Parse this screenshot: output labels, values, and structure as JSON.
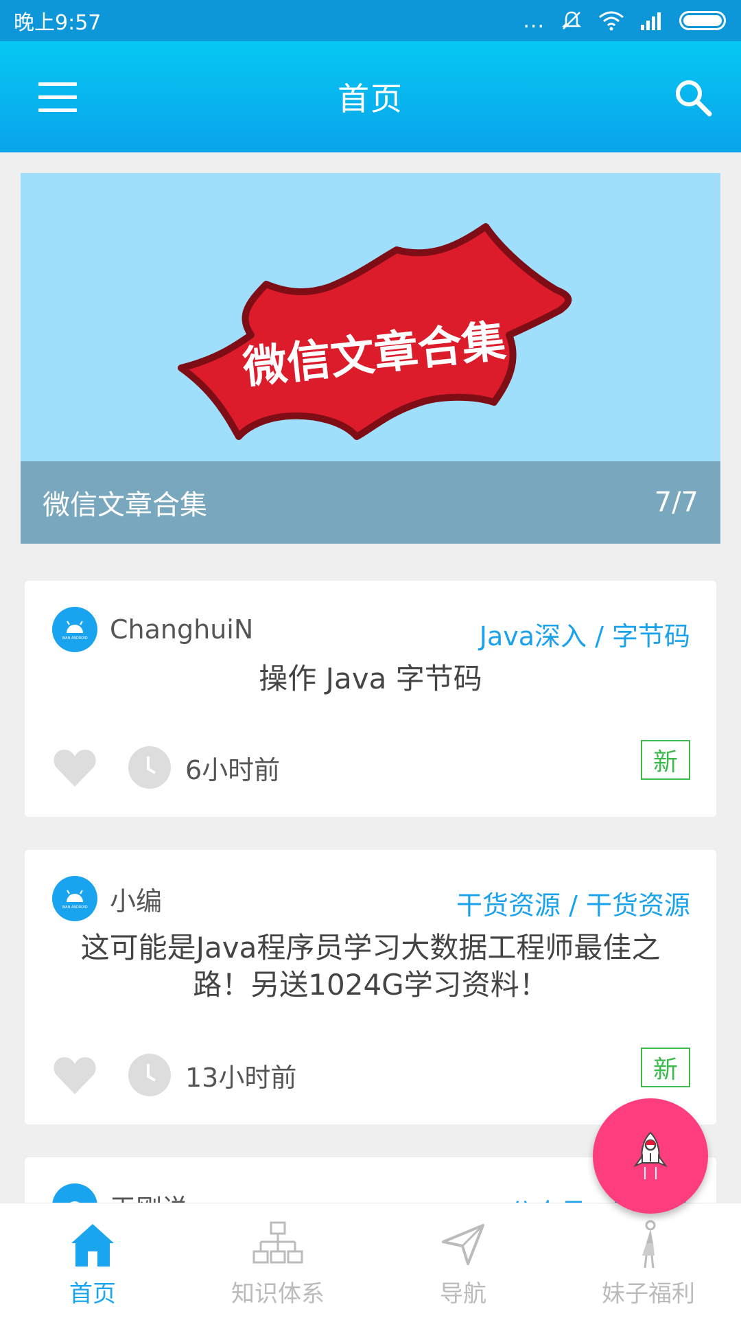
{
  "status_bar": {
    "time": "晚上9:57",
    "dots": "..."
  },
  "app_bar": {
    "title": "首页"
  },
  "banner": {
    "art_text": "微信文章合集",
    "caption": "微信文章合集",
    "indicator": "7/7"
  },
  "articles": [
    {
      "author": "ChanghuiN",
      "category": "Java深入 / 字节码",
      "title": "操作 Java 字节码",
      "time": "6小时前",
      "badge": "新"
    },
    {
      "author": "小编",
      "category": "干货资源 / 干货资源",
      "title": "这可能是Java程序员学习大数据工程师最佳之路！另送1024G学习资料！",
      "time": "13小时前",
      "badge": "新"
    },
    {
      "author": "王刚说",
      "category": "公众号 / 王刚说"
    }
  ],
  "bottom_nav": [
    {
      "label": "首页",
      "active": true
    },
    {
      "label": "知识体系"
    },
    {
      "label": "导航"
    },
    {
      "label": "妹子福利"
    }
  ],
  "colors": {
    "accent": "#1ca5ef",
    "fab": "#fd3d7d",
    "badge": "#3dba4e"
  }
}
